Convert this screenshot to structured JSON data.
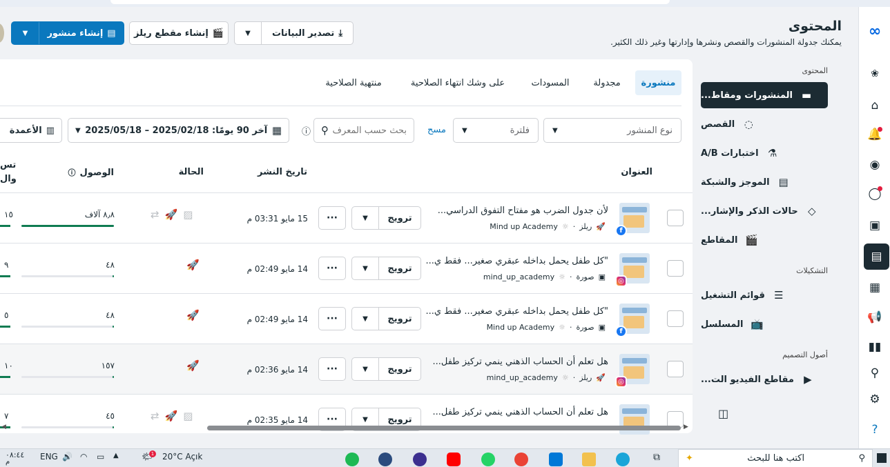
{
  "header": {
    "title": "المحتوى",
    "subtitle": "يمكنك جدولة المنشورات والقصص ونشرها وإدارتها وغير ذلك الكثير.",
    "export_label": "تصدير البيانات",
    "create_reel_label": "إنشاء مقطع ريلز",
    "create_post_label": "إنشاء منشور"
  },
  "nav": {
    "section_content": "المحتوى",
    "items_content": [
      "المنشورات ومقاط...",
      "القصص",
      "اختبارات A/B",
      "الموجز والشبكة",
      "حالات الذكر والإشار...",
      "المقاطع"
    ],
    "section_formations": "التشكيلات",
    "items_formations": [
      "قوائم التشغيل",
      "المسلسل"
    ],
    "section_assets": "أصول التصميم",
    "items_assets": [
      "مقاطع الفيديو الت..."
    ]
  },
  "tabs": [
    "منشورة",
    "مجدولة",
    "المسودات",
    "على وشك انتهاء الصلاحية",
    "منتهية الصلاحية"
  ],
  "filters": {
    "post_type_placeholder": "نوع المنشور",
    "filter_placeholder": "فلترة",
    "clear_label": "مسح",
    "search_placeholder": "بحث حسب المعرف",
    "date_range": "آخر 90 يومًا: 2025/02/18 – 2025/05/18",
    "columns_label": "الأعمدة"
  },
  "table": {
    "headers": {
      "title": "العنوان",
      "publish_date": "تاريخ النشر",
      "status": "الحالة",
      "reach": "الوصول",
      "edge_top": "تس",
      "edge_bottom": "وال"
    },
    "promote_label": "ترويج",
    "more_label": "···",
    "rows": [
      {
        "title": "لأن جدول الضرب هو مفتاح التفوق الدراسي... ",
        "type": "ريلز",
        "account": "Mind up Academy",
        "platform": "facebook",
        "date": "15 مايو 03:31 م",
        "reach": "٨٫٨ آلاف",
        "reach_fraction": 1.0,
        "edge": "١٥"
      },
      {
        "title": "\"كل طفل يحمل بداخله عبقري صغير... فقط ي...",
        "type": "صورة",
        "account": "mind_up_academy",
        "platform": "instagram",
        "date": "14 مايو 02:49 م",
        "reach": "٤٨",
        "reach_fraction": 0.006,
        "edge": "٩"
      },
      {
        "title": "\"كل طفل يحمل بداخله عبقري صغير... فقط ي...",
        "type": "صورة",
        "account": "Mind up Academy",
        "platform": "facebook",
        "date": "14 مايو 02:49 م",
        "reach": "٤٨",
        "reach_fraction": 0.006,
        "edge": "٥"
      },
      {
        "title": "هل تعلم أن الحساب الذهني ينمي تركيز طفل...",
        "type": "ريلز",
        "account": "mind_up_academy",
        "platform": "instagram",
        "date": "14 مايو 02:36 م",
        "reach": "١٥٧",
        "reach_fraction": 0.018,
        "edge": "١٠"
      },
      {
        "title": "هل تعلم أن الحساب الذهني ينمي تركيز طفل...",
        "type": "",
        "account": "",
        "platform": "",
        "date": "14 مايو 02:35 م",
        "reach": "٤٥",
        "reach_fraction": 0.005,
        "edge": "٧"
      }
    ]
  },
  "taskbar": {
    "time": "٠٨:٤٤",
    "period": "م",
    "lang": "ENG",
    "weather": "20°C  Açık",
    "notify_count": "1",
    "search_placeholder": "اكتب هنا للبحث"
  },
  "colors": {
    "accent": "#0a78be",
    "dark": "#1c2b33",
    "success": "#0f7b52"
  }
}
